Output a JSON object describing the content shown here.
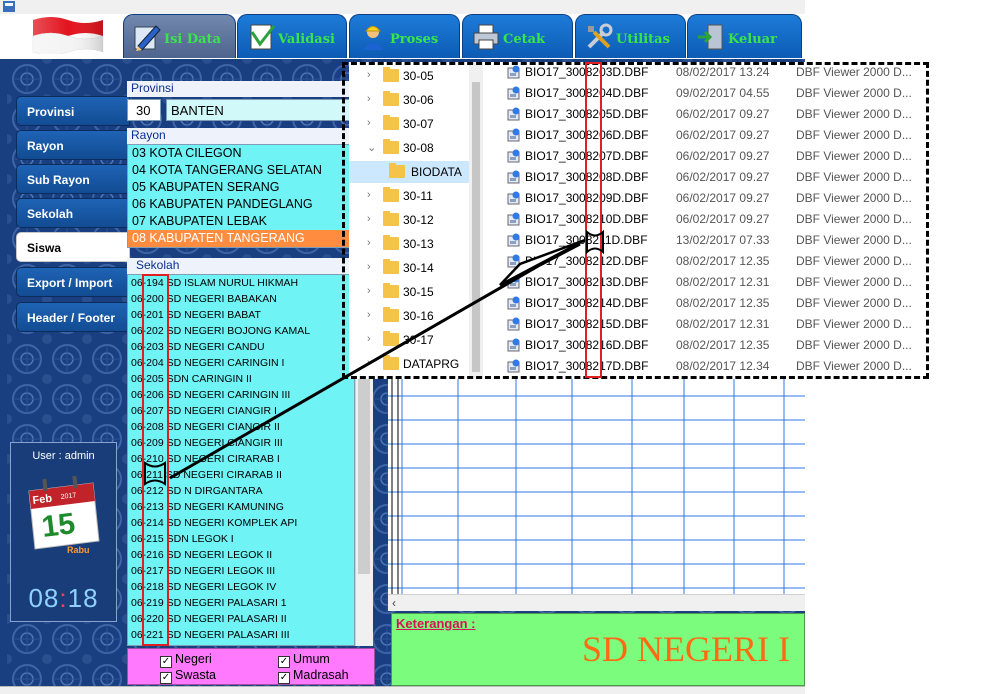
{
  "tabs": [
    {
      "label": "Isi Data",
      "icon": "pencil-ruler-icon",
      "active": true
    },
    {
      "label": "Validasi",
      "icon": "document-check-icon",
      "active": false
    },
    {
      "label": "Proses",
      "icon": "worker-icon",
      "active": false
    },
    {
      "label": "Cetak",
      "icon": "printer-icon",
      "active": false
    },
    {
      "label": "Utilitas",
      "icon": "tools-icon",
      "active": false
    },
    {
      "label": "Keluar",
      "icon": "exit-door-icon",
      "active": false
    }
  ],
  "sidebar": {
    "items": [
      {
        "label": "Provinsi"
      },
      {
        "label": "Rayon"
      },
      {
        "label": "Sub Rayon"
      },
      {
        "label": "Sekolah"
      },
      {
        "label": "Siswa",
        "active": true
      },
      {
        "label": "Export / Import"
      },
      {
        "label": "Header / Footer"
      }
    ]
  },
  "user": {
    "label": "User : admin",
    "calendar": {
      "month": "Feb",
      "year": "2017",
      "day": "15",
      "weekday": "Rabu"
    },
    "clock": {
      "hour": "08",
      "minute": "18"
    }
  },
  "provinsi": {
    "label": "Provinsi",
    "code": "30",
    "name": "BANTEN"
  },
  "rayon": {
    "label": "Rayon",
    "items": [
      "03  KOTA CILEGON",
      "04  KOTA TANGERANG SELATAN",
      "05  KABUPATEN SERANG",
      "06  KABUPATEN PANDEGLANG",
      "07  KABUPATEN LEBAK",
      "08  KABUPATEN TANGERANG"
    ],
    "selected_index": 5
  },
  "sekolah": {
    "label": "Sekolah",
    "items": [
      "06-194  SD ISLAM NURUL HIKMAH",
      "06-200  SD NEGERI BABAKAN",
      "06-201  SD NEGERI BABAT",
      "06-202  SD NEGERI BOJONG KAMAL",
      "06-203  SD NEGERI CANDU",
      "06-204  SD NEGERI CARINGIN I",
      "06-205  SDN CARINGIN II",
      "06-206  SD NEGERI CARINGIN III",
      "06-207  SD NEGERI CIANGIR I",
      "06-208  SD NEGERI CIANGIR II",
      "06-209  SD NEGERI CIANGIR III",
      "06-210  SD NEGERI CIRARAB I",
      "06-211  SD NEGERI CIRARAB II",
      "06-212  SD N DIRGANTARA",
      "06-213  SD NEGERI KAMUNING",
      "06-214  SD NEGERI KOMPLEK API",
      "06-215  SDN LEGOK I",
      "06-216  SD NEGERI LEGOK II",
      "06-217  SD NEGERI LEGOK III",
      "06-218  SD NEGERI LEGOK IV",
      "06-219  SD NEGERI PALASARI 1",
      "06-220  SD NEGERI PALASARI II",
      "06-221  SD NEGERI PALASARI III"
    ]
  },
  "filters": [
    {
      "label": "Negeri",
      "checked": true
    },
    {
      "label": "Umum",
      "checked": true
    },
    {
      "label": "Swasta",
      "checked": true
    },
    {
      "label": "Madrasah",
      "checked": true
    }
  ],
  "keterangan": {
    "label": "Keterangan :",
    "value": "SD NEGERI I"
  },
  "explorer": {
    "tree": [
      {
        "label": "30-05",
        "expanded": false
      },
      {
        "label": "30-06",
        "expanded": false
      },
      {
        "label": "30-07",
        "expanded": false
      },
      {
        "label": "30-08",
        "expanded": true
      },
      {
        "label": "BIODATA",
        "child": true,
        "selected": true
      },
      {
        "label": "30-11",
        "expanded": false
      },
      {
        "label": "30-12",
        "expanded": false
      },
      {
        "label": "30-13",
        "expanded": false
      },
      {
        "label": "30-14",
        "expanded": false
      },
      {
        "label": "30-15",
        "expanded": false
      },
      {
        "label": "30-16",
        "expanded": false
      },
      {
        "label": "30-17",
        "expanded": false
      },
      {
        "label": "DATAPRG",
        "expanded": false
      }
    ],
    "files": [
      {
        "name": "BIO17_3008203D.DBF",
        "date": "08/02/2017 13.24",
        "type": "DBF Viewer 2000 D..."
      },
      {
        "name": "BIO17_3008204D.DBF",
        "date": "09/02/2017 04.55",
        "type": "DBF Viewer 2000 D..."
      },
      {
        "name": "BIO17_3008205D.DBF",
        "date": "06/02/2017 09.27",
        "type": "DBF Viewer 2000 D..."
      },
      {
        "name": "BIO17_3008206D.DBF",
        "date": "06/02/2017 09.27",
        "type": "DBF Viewer 2000 D..."
      },
      {
        "name": "BIO17_3008207D.DBF",
        "date": "06/02/2017 09.27",
        "type": "DBF Viewer 2000 D..."
      },
      {
        "name": "BIO17_3008208D.DBF",
        "date": "06/02/2017 09.27",
        "type": "DBF Viewer 2000 D..."
      },
      {
        "name": "BIO17_3008209D.DBF",
        "date": "06/02/2017 09.27",
        "type": "DBF Viewer 2000 D..."
      },
      {
        "name": "BIO17_3008210D.DBF",
        "date": "06/02/2017 09.27",
        "type": "DBF Viewer 2000 D..."
      },
      {
        "name": "BIO17_3008211D.DBF",
        "date": "13/02/2017 07.33",
        "type": "DBF Viewer 2000 D..."
      },
      {
        "name": "BIO17_3008212D.DBF",
        "date": "08/02/2017 12.35",
        "type": "DBF Viewer 2000 D..."
      },
      {
        "name": "BIO17_3008213D.DBF",
        "date": "08/02/2017 12.31",
        "type": "DBF Viewer 2000 D..."
      },
      {
        "name": "BIO17_3008214D.DBF",
        "date": "08/02/2017 12.35",
        "type": "DBF Viewer 2000 D..."
      },
      {
        "name": "BIO17_3008215D.DBF",
        "date": "08/02/2017 12.31",
        "type": "DBF Viewer 2000 D..."
      },
      {
        "name": "BIO17_3008216D.DBF",
        "date": "08/02/2017 12.35",
        "type": "DBF Viewer 2000 D..."
      },
      {
        "name": "BIO17_3008217D.DBF",
        "date": "08/02/2017 12.34",
        "type": "DBF Viewer 2000 D..."
      }
    ]
  },
  "colors": {
    "frame_blue": "#1a3f80",
    "tab_label_green": "#39e64a",
    "list_cyan": "#6ff3f5",
    "selected_orange": "#ff8c3f",
    "filter_pink": "#ff79ff",
    "keterangan_green": "#7cfc7c",
    "highlight_red": "#e02020"
  }
}
